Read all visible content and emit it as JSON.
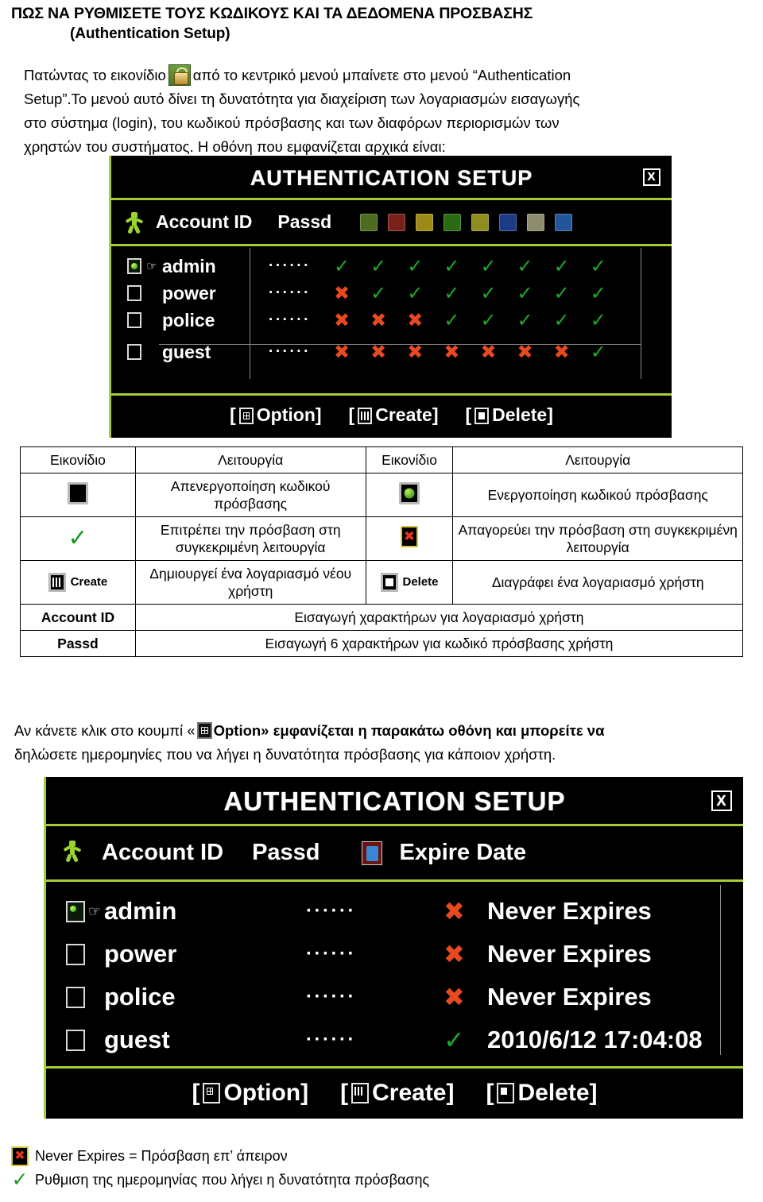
{
  "document": {
    "title": "ΠΩΣ ΝΑ ΡΥΘΜΙΣΕΤΕ ΤΟΥΣ ΚΩΔΙΚΟΥΣ ΚΑΙ ΤΑ ΔΕΔΟΜΕΝΑ ΠΡΟΣΒΑΣΗΣ",
    "subtitle": "(Authentication Setup)"
  },
  "intro": {
    "line1_a": "Πατώντας το εικονίδιο",
    "icon": "lock-icon",
    "line1_b": "από το κεντρικό μενού μπαίνετε στο μενού “Authentication",
    "line2": "Setup”.Το μενού αυτό δίνει τη δυνατότητα για διαχείριση των λογαριασμών εισαγωγής",
    "line3": "στο σύστημα (login), του κωδικού πρόσβασης και των διαφόρων περιορισμών των",
    "line4": "χρηστών του συστήματος. Η οθόνη που εμφανίζεται αρχικά είναι:"
  },
  "dialog1": {
    "title": "AUTHENTICATION SETUP",
    "close_label": "X",
    "columns": {
      "runner_icon": "runner-icon",
      "account_id": "Account ID",
      "passd": "Passd"
    },
    "permission_icons": [
      {
        "name": "setup-icon",
        "color": "#7fae2e"
      },
      {
        "name": "no-record-icon",
        "color": "#c8362a"
      },
      {
        "name": "book-icon",
        "color": "#d8c330"
      },
      {
        "name": "playback-icon",
        "color": "#3fa21c"
      },
      {
        "name": "search-icon",
        "color": "#cfcf45"
      },
      {
        "name": "backup-icon",
        "color": "#2d5fd0"
      },
      {
        "name": "network-icon",
        "color": "#d8d8b0"
      },
      {
        "name": "remote-icon",
        "color": "#3d7fe0"
      }
    ],
    "rows": [
      {
        "selected": true,
        "account": "admin",
        "passd": "······",
        "perms": [
          "ok",
          "ok",
          "ok",
          "ok",
          "ok",
          "ok",
          "ok",
          "ok"
        ]
      },
      {
        "selected": false,
        "account": "power",
        "passd": "······",
        "perms": [
          "no",
          "ok",
          "ok",
          "ok",
          "ok",
          "ok",
          "ok",
          "ok"
        ]
      },
      {
        "selected": false,
        "account": "police",
        "passd": "······",
        "perms": [
          "no",
          "no",
          "no",
          "ok",
          "ok",
          "ok",
          "ok",
          "ok"
        ]
      },
      {
        "selected": false,
        "account": "guest",
        "passd": "······",
        "perms": [
          "no",
          "no",
          "no",
          "no",
          "no",
          "no",
          "no",
          "ok"
        ]
      }
    ],
    "buttons": [
      {
        "glyph": "option-grid-icon",
        "label": "Option]",
        "prefix": "["
      },
      {
        "glyph": "create-bars-icon",
        "label": "Create]",
        "prefix": "["
      },
      {
        "glyph": "delete-solid-icon",
        "label": "Delete]",
        "prefix": "["
      }
    ]
  },
  "legend_table": {
    "headers": [
      "Εικονίδιο",
      "Λειτουργία",
      "Εικονίδιο",
      "Λειτουργία"
    ],
    "rows": [
      {
        "icon1": "password-disabled-icon",
        "icon1_label": "",
        "desc1": "Απενεργοποίηση κωδικού πρόσβασης",
        "icon2": "password-enabled-icon",
        "icon2_label": "",
        "desc2": "Ενεργοποίηση κωδικού πρόσβασης"
      },
      {
        "icon1": "green-check-icon",
        "icon1_label": "",
        "desc1": "Επιτρέπει την πρόσβαση στη συγκεκριμένη λειτουργία",
        "icon2": "red-cross-icon",
        "icon2_label": "",
        "desc2": "Απαγορεύει την πρόσβαση στη συγκεκριμένη λειτουργία"
      },
      {
        "icon1": "create-icon",
        "icon1_label": "Create",
        "desc1": "Δημιουργεί ένα λογαριασμό νέου χρήστη",
        "icon2": "delete-icon",
        "icon2_label": "Delete",
        "desc2": "Διαγράφει ένα λογαριασμό χρήστη"
      }
    ],
    "span_rows": [
      {
        "label": "Account ID",
        "desc": "Εισαγωγή χαρακτήρων για λογαριασμό χρήστη"
      },
      {
        "label": "Passd",
        "desc": "Εισαγωγή 6 χαρακτήρων για κωδικό πρόσβασης χρήστη"
      }
    ]
  },
  "mid_text": {
    "line1_a": "Αν κάνετε κλικ στο κουμπί «",
    "icon": "option-grid-icon",
    "line1_b": "Option» εμφανίζεται η παρακάτω οθόνη και μπορείτε να",
    "line2": "δηλώσετε ημερομηνίες που να λήγει η δυνατότητα πρόσβασης για κάποιον χρήστη."
  },
  "dialog2": {
    "title": "AUTHENTICATION SETUP",
    "close_label": "X",
    "columns": {
      "runner_icon": "runner-icon",
      "account_id": "Account ID",
      "passd": "Passd",
      "expire_icon": "expire-date-icon",
      "expire_date": "Expire Date"
    },
    "rows": [
      {
        "selected": true,
        "account": "admin",
        "passd": "······",
        "state": "no",
        "expire": "Never Expires"
      },
      {
        "selected": false,
        "account": "power",
        "passd": "······",
        "state": "no",
        "expire": "Never Expires"
      },
      {
        "selected": false,
        "account": "police",
        "passd": "······",
        "state": "no",
        "expire": "Never Expires"
      },
      {
        "selected": false,
        "account": "guest",
        "passd": "······",
        "state": "ok",
        "expire": "2010/6/12 17:04:08"
      }
    ],
    "buttons": [
      {
        "glyph": "option-grid-icon",
        "label": "Option]",
        "prefix": "["
      },
      {
        "glyph": "create-bars-icon",
        "label": "Create]",
        "prefix": "["
      },
      {
        "glyph": "delete-solid-icon",
        "label": "Delete]",
        "prefix": "["
      }
    ]
  },
  "footnotes": [
    {
      "icon": "red-cross-icon",
      "text": "Never Expires = Πρόσβαση επ’ άπειρον"
    },
    {
      "icon": "green-check-icon",
      "text": "Ρυθμιση της ημερομηνίας που λήγει η δυνατότητα πρόσβασης"
    }
  ],
  "colors": {
    "dvr_border": "#a4cd36",
    "dvr_background": "#000000",
    "tick_green": "#1fa82b",
    "cross_red": "#e8491f"
  }
}
